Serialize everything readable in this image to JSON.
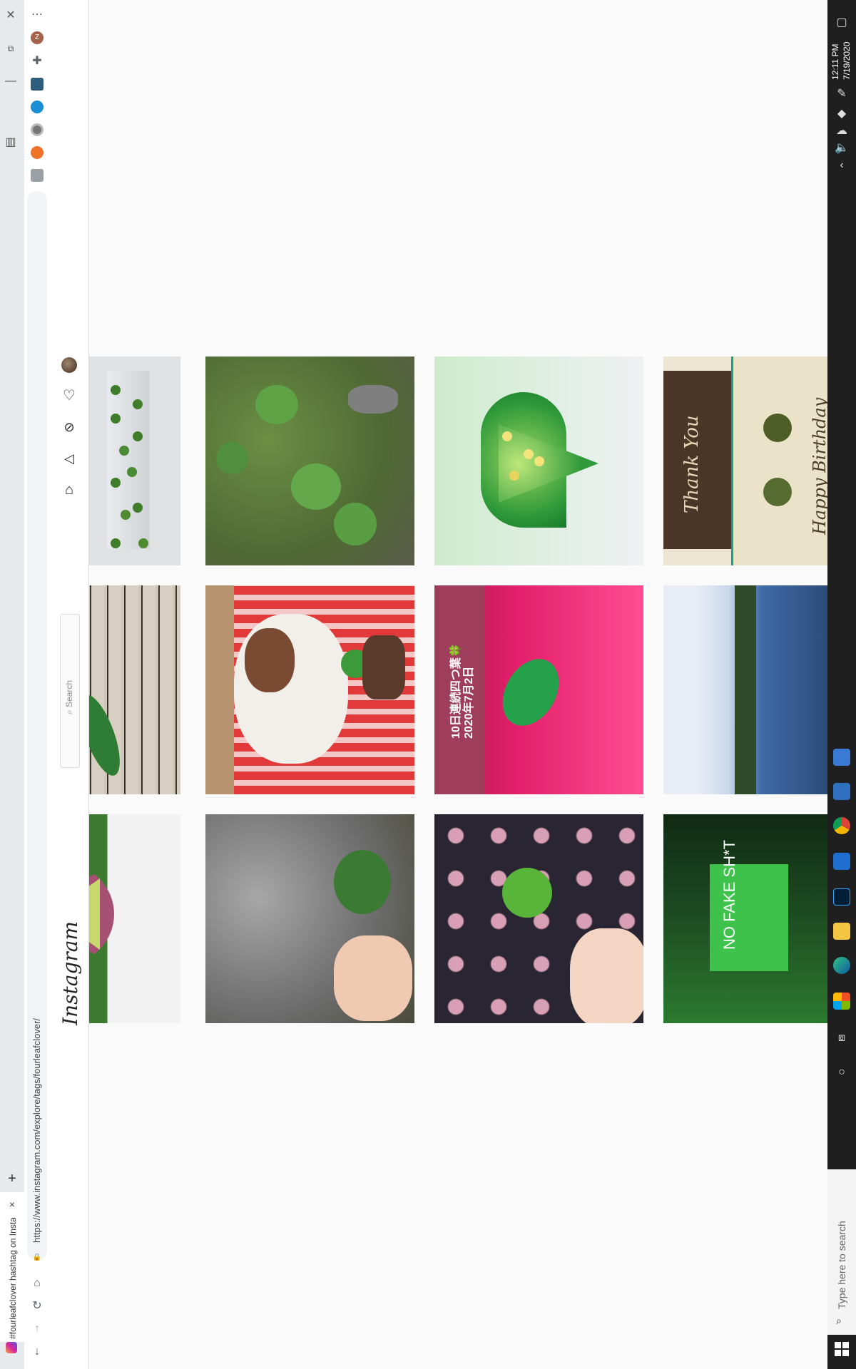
{
  "browser": {
    "tab_title": "#fourleafclover hashtag on Insta",
    "url": "https://www.instagram.com/explore/tags/fourleafclover/",
    "new_tab_label": "+",
    "close_tab_label": "×",
    "menu_label": "⋯"
  },
  "instagram": {
    "logo": "Instagram",
    "search_placeholder": "Search"
  },
  "system": {
    "time": "12:11 PM",
    "date": "7/19/2020",
    "search_placeholder": "Type here to search"
  },
  "posts": [
    {
      "theme": "clover-prints-on-paper",
      "colors": [
        "#c9cdd0",
        "#e4e6e8",
        "#3f7d2a"
      ]
    },
    {
      "theme": "four-leaf-clovers-on-grass",
      "colors": [
        "#4f6a34",
        "#6b8f45",
        "#8a9b7a"
      ]
    },
    {
      "theme": "quilled-paper-heart",
      "colors": [
        "#d9efd3",
        "#2f9a3a",
        "#8ccf6a"
      ]
    },
    {
      "theme": "birthday-card-clover",
      "colors": [
        "#e8e2cf",
        "#4a3526",
        "#556b2f"
      ]
    },
    {
      "theme": "book-page-clover",
      "colors": [
        "#d7cfc2",
        "#2e2a26",
        "#2f7d34"
      ]
    },
    {
      "theme": "puppy-on-striped-blanket",
      "colors": [
        "#e23a3a",
        "#f5c7c7",
        "#7a4a33"
      ]
    },
    {
      "theme": "clover-on-pink-leather",
      "colors": [
        "#e3206b",
        "#b1174f",
        "#24a14a"
      ]
    },
    {
      "theme": "lake-and-sky",
      "colors": [
        "#3e6aa5",
        "#e9eef6",
        "#2f4a2a"
      ]
    },
    {
      "theme": "leaf-closeup",
      "colors": [
        "#3c7b2f",
        "#f2f2f2",
        "#a55072"
      ]
    },
    {
      "theme": "dog-with-clover",
      "colors": [
        "#6b6b6b",
        "#a7a7a7",
        "#3b7a32"
      ]
    },
    {
      "theme": "clover-on-floral-fabric",
      "colors": [
        "#2a2533",
        "#d9a0b5",
        "#58b53a"
      ]
    },
    {
      "theme": "green-aesthetic-collage",
      "colors": [
        "#1e4d22",
        "#3ec24b",
        "#0f2a12"
      ]
    }
  ],
  "post_texts": {
    "pink_leather": "10日連続四つ葉🍀 2020年7月2日",
    "collage": "NO FAKE SH*T",
    "card": "Happy Birthday",
    "card2": "Thank You"
  }
}
